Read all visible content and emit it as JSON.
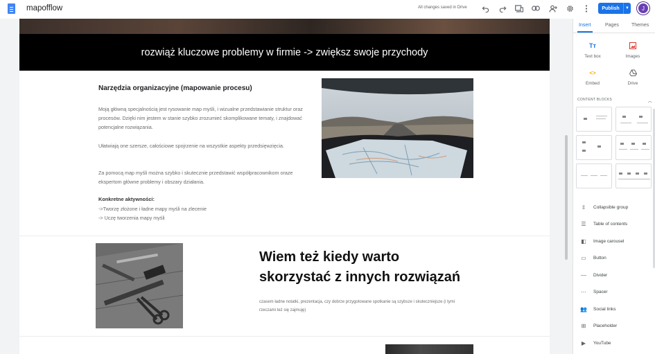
{
  "app": {
    "title": "mapofflow",
    "saved_status": "All changes saved in Drive",
    "publish_label": "Publish",
    "avatar_initial": "J"
  },
  "toolbar_icons": [
    "undo-icon",
    "redo-icon",
    "preview-devices-icon",
    "link-icon",
    "share-person-icon",
    "settings-gear-icon",
    "more-vert-icon"
  ],
  "page": {
    "banner_text": "rozwiąż kluczowe problemy  w firmie ->  zwiększ swoje przychody",
    "section1": {
      "title": "Narzędzia organizacyjne (mapowanie procesu)",
      "paragraphs": [
        "Moją główną specjalnością jest rysowanie map myśli, i wizualne przedstawianie struktur oraz procesów. Dzięki nim jestem w stanie szybko zrozumieć skomplikowane tematy, i znajdować potencjalne rozwiązania.",
        "Ułatwiają one szersze, całościowe spojrzenie na wszystkie aspekty przedsięwzięcia.",
        "Za pomocą map myśli można szybko i skutecznie przedstawić współpracownikom oraze ekspertom główne problemy i obszary działania."
      ],
      "activities_title": "Konkretne aktywności:",
      "activities": [
        "->Tworzę złożone i ładne mapy myśli na zlecenie",
        "-> Uczę tworzenia  mapy myśli"
      ]
    },
    "section2": {
      "title_line1": "Wiem też kiedy warto",
      "title_line2": "skorzystać z innych rozwiązań",
      "body": "czasem ładne notatki, prezentacja, czy dobrze przygotowane spotkanie są szybsze i skuteczniejsze (i tymi rzeczami też się zajmuję)"
    }
  },
  "panel": {
    "tabs": [
      "Insert",
      "Pages",
      "Themes"
    ],
    "active_tab": "Insert",
    "insert_items": [
      {
        "label": "Text box",
        "icon": "text-box-icon"
      },
      {
        "label": "Images",
        "icon": "image-icon"
      },
      {
        "label": "Embed",
        "icon": "embed-code-icon"
      },
      {
        "label": "Drive",
        "icon": "drive-icon"
      }
    ],
    "content_blocks_label": "CONTENT BLOCKS",
    "components": [
      {
        "label": "Collapsible group",
        "icon": "collapsible-group-icon"
      },
      {
        "label": "Table of contents",
        "icon": "table-of-contents-icon"
      },
      {
        "label": "Image carousel",
        "icon": "image-carousel-icon"
      },
      {
        "label": "Button",
        "icon": "button-icon"
      },
      {
        "label": "Divider",
        "icon": "divider-icon"
      },
      {
        "label": "Spacer",
        "icon": "spacer-icon"
      },
      {
        "label": "Social links",
        "icon": "social-links-icon"
      },
      {
        "label": "Placeholder",
        "icon": "placeholder-icon"
      },
      {
        "label": "YouTube",
        "icon": "youtube-icon"
      }
    ]
  },
  "colors": {
    "accent": "#1a73e8",
    "avatar": "#6a3fb5",
    "banner_bg": "#000000"
  }
}
